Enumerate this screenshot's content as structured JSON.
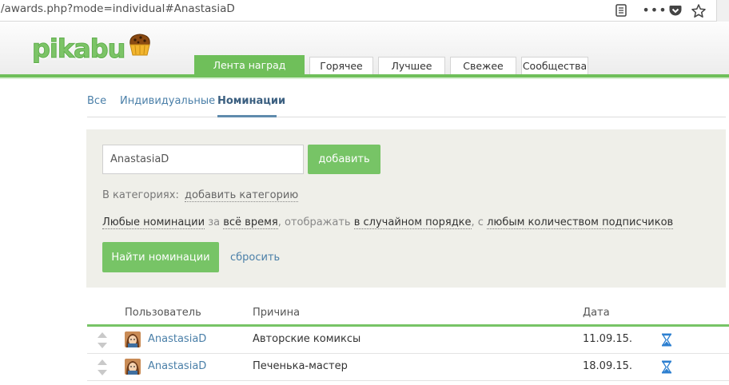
{
  "browser": {
    "url": "/awards.php?mode=individual#AnastasiaD",
    "icons": [
      "reader-view-icon",
      "more-icon",
      "pocket-icon",
      "bookmark-star-icon"
    ]
  },
  "site": {
    "logo_text": "pikabu",
    "brand_color": "#6fbf5a",
    "nav": [
      {
        "label": "Лента наград",
        "active": true
      },
      {
        "label": "Горячее",
        "active": false
      },
      {
        "label": "Лучшее",
        "active": false
      },
      {
        "label": "Свежее",
        "active": false
      },
      {
        "label": "Сообщества",
        "active": false
      }
    ]
  },
  "subtabs": [
    {
      "label": "Все",
      "active": false
    },
    {
      "label": "Индивидуальные",
      "active": false
    },
    {
      "label": "Номинации",
      "active": true
    }
  ],
  "filter": {
    "search_value": "AnastasiaD",
    "add_button": "добавить",
    "categories_label": "В категориях:",
    "add_category_link": "добавить категорию",
    "phrase": {
      "nominations": "Любые номинации",
      "for": " за ",
      "period": "всё время",
      "show": ", отображать ",
      "order": "в случайном порядке",
      "with": ", с ",
      "subscribers": "любым количеством подписчиков"
    },
    "find_button": "Найти номинации",
    "reset_link": "сбросить"
  },
  "table": {
    "headers": {
      "user": "Пользователь",
      "reason": "Причина",
      "date": "Дата"
    },
    "rows": [
      {
        "user": "AnastasiaD",
        "reason": "Авторские комиксы",
        "date": "11.09.15."
      },
      {
        "user": "AnastasiaD",
        "reason": "Печенька-мастер",
        "date": "18.09.15."
      }
    ]
  }
}
